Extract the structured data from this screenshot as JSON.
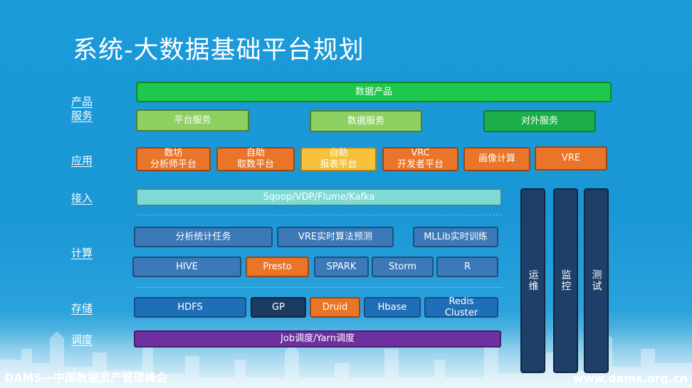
{
  "title": "系统-大数据基础平台规划",
  "labels": {
    "product": [
      "产品",
      "服务"
    ],
    "app": "应用",
    "access": "接入",
    "compute": "计算",
    "storage": "存储",
    "schedule": "调度"
  },
  "product_layer": {
    "top": "数据产品",
    "services": [
      "平台服务",
      "数据服务",
      "对外服务"
    ]
  },
  "apps": [
    [
      "数坊",
      "分析师平台"
    ],
    [
      "自助",
      "取数平台"
    ],
    [
      "自助",
      "报表平台"
    ],
    [
      "VRC",
      "开发者平台"
    ],
    [
      "画像计算"
    ],
    [
      "VRE"
    ]
  ],
  "access": "Sqoop/VDP/Flume/Kafka",
  "compute_row1": [
    "分析统计任务",
    "VRE实时算法预测",
    "MLLib实时训练"
  ],
  "compute_row2": [
    "HIVE",
    "Presto",
    "SPARK",
    "Storm",
    "R"
  ],
  "storage": [
    "HDFS",
    "GP",
    "Druid",
    "Hbase",
    "Redis Cluster"
  ],
  "storage_redis_lines": [
    "Redis",
    "Cluster"
  ],
  "schedule": "Job调度/Yarn调度",
  "side_bars": [
    "运维",
    "监控",
    "测试"
  ],
  "footer": {
    "left": "DAMS—中国数据资产管理峰会",
    "right": "www.dams.org.cn"
  }
}
